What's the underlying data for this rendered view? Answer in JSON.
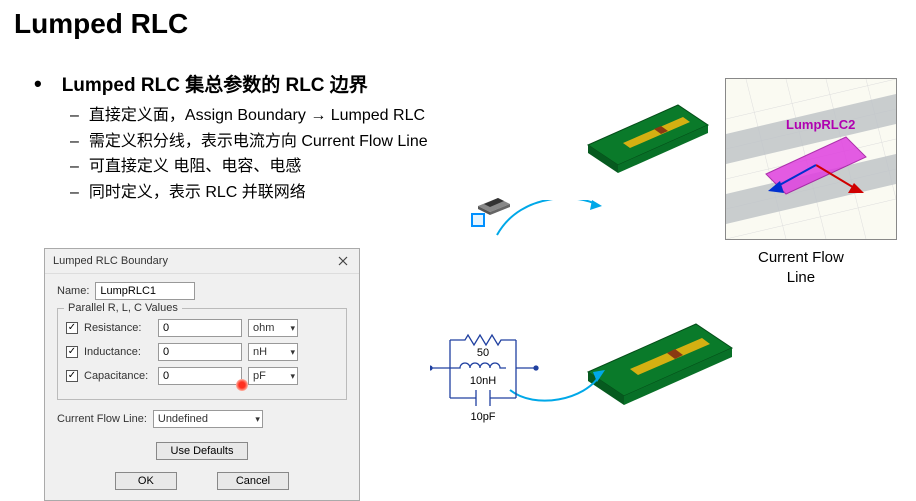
{
  "slide": {
    "title": "Lumped RLC"
  },
  "bullets": {
    "main": "Lumped RLC 集总参数的 RLC 边界",
    "subs": [
      "直接定义面，Assign Boundary → Lumped RLC",
      "需定义积分线，表示电流方向 Current Flow Line",
      "可直接定义 电阻、电容、电感",
      "同时定义，表示 RLC 并联网络"
    ]
  },
  "dialog": {
    "title": "Lumped RLC Boundary",
    "name_label": "Name:",
    "name_value": "LumpRLC1",
    "fieldset_label": "Parallel R, L, C Values",
    "rows": [
      {
        "label": "Resistance:",
        "value": "0",
        "unit": "ohm"
      },
      {
        "label": "Inductance:",
        "value": "0",
        "unit": "nH"
      },
      {
        "label": "Capacitance:",
        "value": "0",
        "unit": "pF"
      }
    ],
    "cfl_label": "Current Flow Line:",
    "cfl_value": "Undefined",
    "btn_defaults": "Use Defaults",
    "btn_ok": "OK",
    "btn_cancel": "Cancel"
  },
  "zoom": {
    "annotation": "LumpRLC2",
    "caption_l1": "Current Flow",
    "caption_l2": "Line"
  },
  "circuit": {
    "r_val": "50",
    "l_val": "10nH",
    "c_val": "10pF"
  }
}
